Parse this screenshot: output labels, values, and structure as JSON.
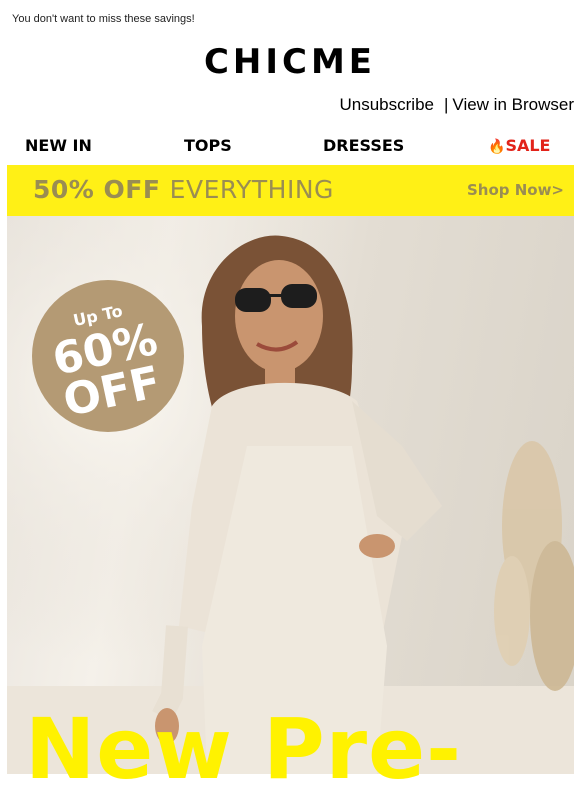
{
  "preheader": "You don't want to miss these savings!",
  "brand": "CHICME",
  "links": {
    "unsubscribe": "Unsubscribe",
    "separator": "|",
    "view_in_browser": "View in Browser"
  },
  "nav": {
    "new_in": "NEW IN",
    "tops": "TOPS",
    "dresses": "DRESSES",
    "sale_icon": "🔥",
    "sale": "SALE"
  },
  "promo": {
    "headline_strong": "50% OFF",
    "headline_rest": "EVERYTHING",
    "cta": "Shop Now>"
  },
  "badge": {
    "line1": "Up To",
    "line2": "60%",
    "line3": "OFF"
  },
  "hero_headline": "New Pre-",
  "colors": {
    "promo_bg": "#fff016",
    "promo_text": "#9a8d52",
    "sale": "#e2231a",
    "headline": "#fff200",
    "badge": "#b49a74"
  }
}
